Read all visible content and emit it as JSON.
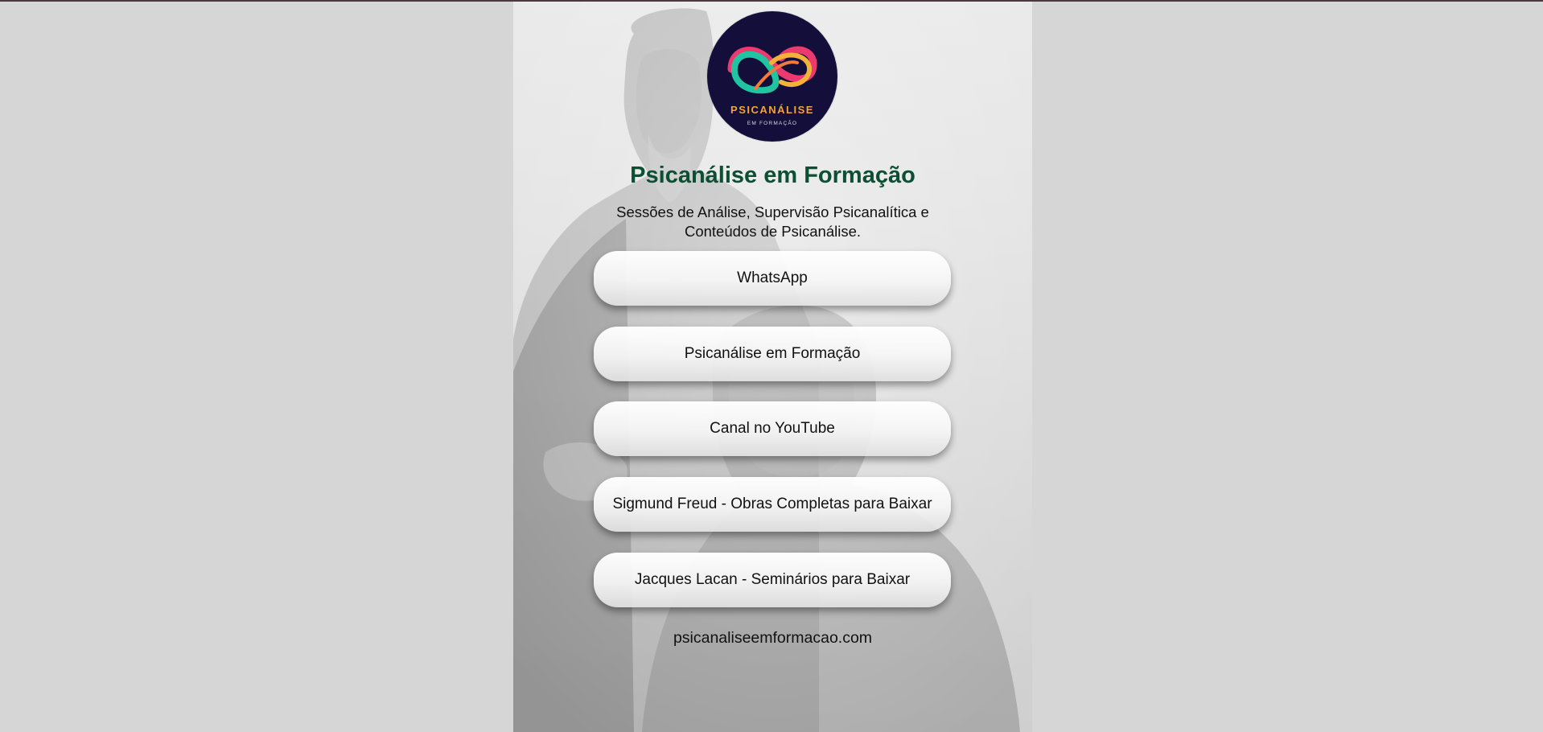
{
  "logo": {
    "word": "PSICANÁLISE",
    "sub": "EM FORMAÇÃO",
    "background_color": "#130f3a"
  },
  "profile": {
    "title": "Psicanálise em Formação",
    "description": "Sessões de Análise, Supervisão Psicanalítica e Conteúdos de Psicanálise."
  },
  "links": [
    {
      "label": "WhatsApp"
    },
    {
      "label": "Psicanálise em Formação"
    },
    {
      "label": "Canal no YouTube"
    },
    {
      "label": "Sigmund Freud - Obras Completas para Baixar"
    },
    {
      "label": "Jacques Lacan - Seminários para Baixar"
    }
  ],
  "footer": {
    "site": "psicanaliseemformacao.com"
  },
  "colors": {
    "title": "#0c4f32",
    "page_background": "#d6d6d6"
  }
}
